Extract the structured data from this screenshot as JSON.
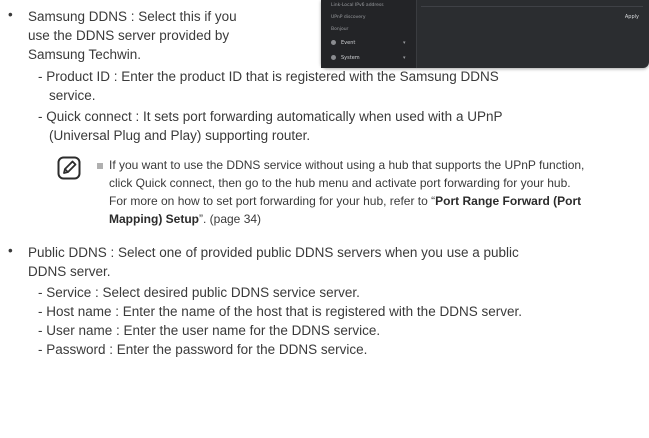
{
  "screenshot": {
    "menu": [
      "Link-Local IPv6 address",
      "UPnP discovery",
      "Bonjour",
      "Event",
      "System"
    ],
    "apply_label": "Apply"
  },
  "samsung_ddns": {
    "lines": [
      "Samsung DDNS : Select this if you",
      "use the DDNS server provided by",
      "Samsung Techwin."
    ],
    "sub": [
      [
        "- Product ID : Enter the product ID that is registered with the Samsung DDNS",
        "service."
      ],
      [
        "- Quick connect : It sets port forwarding automatically when used with a UPnP",
        "(Universal Plug and Play) supporting router."
      ]
    ]
  },
  "note": {
    "line1": "If you want to use the DDNS service without using a hub that supports the UPnP function,",
    "line2": "click Quick connect, then go to the hub menu and activate port forwarding for your hub.",
    "line3_pre": "For more on how to set port forwarding for your hub, refer to “",
    "line3_bold": "Port Range Forward (Port",
    "line4_bold": "Mapping) Setup",
    "line4_post": "”. (page 34)"
  },
  "public_ddns": {
    "lines": [
      "Public DDNS : Select one of provided public DDNS servers when you use a public",
      "DDNS server."
    ],
    "sub": [
      "- Service : Select desired public DDNS service server.",
      "- Host name : Enter the name of the host that is registered with the DDNS server.",
      "- User name : Enter the user name for the DDNS service.",
      "- Password : Enter the password for the DDNS service."
    ]
  }
}
